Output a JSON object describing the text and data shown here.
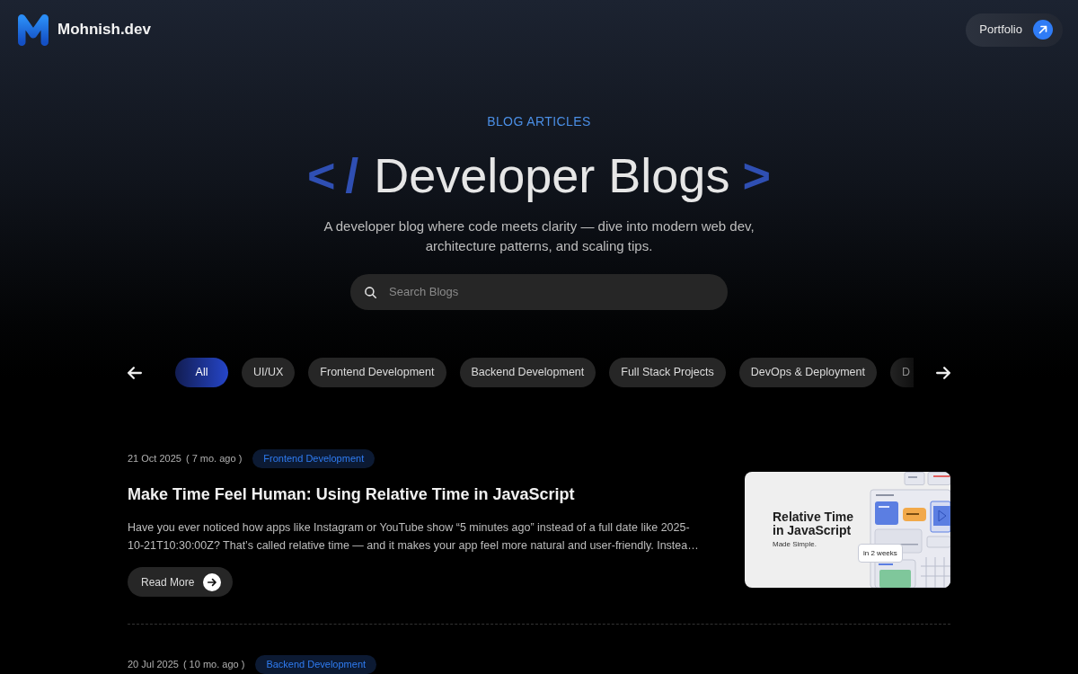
{
  "header": {
    "brand": "Mohnish.dev",
    "button": {
      "label": "Portfolio"
    }
  },
  "hero": {
    "eyebrow": "BLOG ARTICLES",
    "title": {
      "prefix": "</",
      "text": "Developer Blogs",
      "suffix": ">"
    },
    "subtitle": "A developer blog where code meets clarity — dive into modern web dev, architecture patterns, and scaling tips.",
    "search": {
      "placeholder": "Search Blogs"
    }
  },
  "categories": [
    {
      "label": "All",
      "selected": true,
      "cut": false
    },
    {
      "label": "UI/UX",
      "selected": false,
      "cut": false
    },
    {
      "label": "Frontend Development",
      "selected": false,
      "cut": false
    },
    {
      "label": "Backend Development",
      "selected": false,
      "cut": false
    },
    {
      "label": "Full Stack Projects",
      "selected": false,
      "cut": false
    },
    {
      "label": "DevOps & Deployment",
      "selected": false,
      "cut": false
    },
    {
      "label": "D",
      "selected": false,
      "cut": true
    }
  ],
  "articles": [
    {
      "date": "21 Oct 2025",
      "age": "( 7 mo. ago )",
      "tag": "Frontend Development",
      "title": "Make Time Feel Human: Using Relative Time in JavaScript",
      "excerpt": "Have you ever noticed how apps like Instagram or YouTube show “5 minutes ago” instead of a full date like 2025-10-21T10:30:00Z? That’s called relative time — and it makes your app feel more natural and user-friendly. Instea…",
      "button": "Read More",
      "cover": {
        "title": "Relative Time in JavaScript",
        "subtitle": "Made Simple.",
        "note": "in 2 weeks"
      }
    },
    {
      "date": "20 Jul 2025",
      "age": "( 10 mo. ago )",
      "tag": "Backend Development"
    }
  ]
}
